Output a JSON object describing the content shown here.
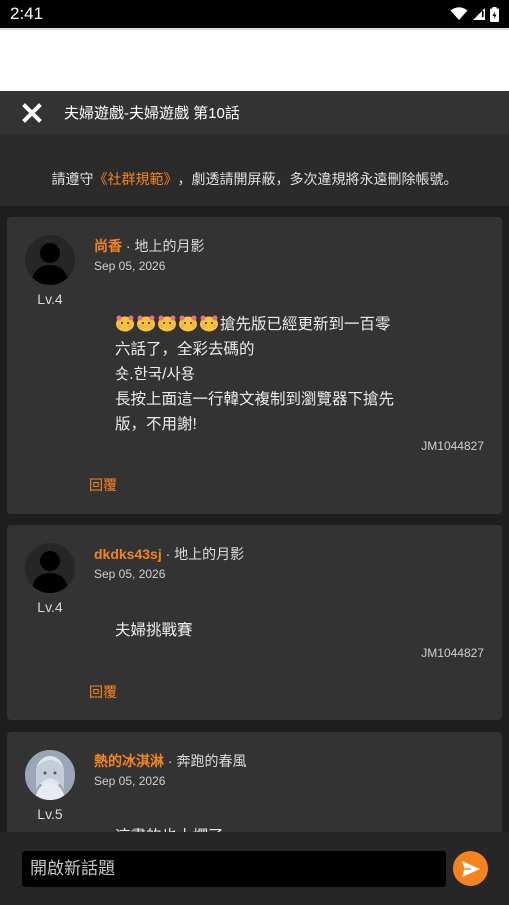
{
  "status_bar": {
    "time": "2:41"
  },
  "top_bar": {
    "title": "夫婦遊戲-夫婦遊戲 第10話"
  },
  "notice": {
    "prefix": "請遵守",
    "rules_link": "《社群規範》",
    "suffix": "，劇透請開屏蔽，多次違規將永遠刪除帳號。"
  },
  "comments": [
    {
      "username": "尚香",
      "subtitle": " · 地上的月影",
      "date": "Sep 05, 2026",
      "level": "Lv.4",
      "emoji_count": 5,
      "lines": [
        "搶先版已經更新到一百零",
        "六話了，全彩去碼的",
        "숏.한국/사용",
        "長按上面這一行韓文複制到瀏覽器下搶先",
        "版，不用謝!"
      ],
      "code": "JM1044827",
      "reply_label": "回覆"
    },
    {
      "username": "dkdks43sj",
      "subtitle": " · 地上的月影",
      "date": "Sep 05, 2026",
      "level": "Lv.4",
      "lines": [
        "夫婦挑戰賽"
      ],
      "code": "JM1044827",
      "reply_label": "回覆"
    },
    {
      "username": "熱的冰淇淋",
      "subtitle": " · 奔跑的春風",
      "date": "Sep 05, 2026",
      "level": "Lv.5",
      "lines": [
        "這畫的也太爛了"
      ]
    }
  ],
  "composer": {
    "placeholder": "開啟新話題"
  },
  "colors": {
    "accent": "#f5841f",
    "card": "#333333",
    "background": "#1e1e1e"
  },
  "icons": {
    "close": "close-icon",
    "send": "send-icon",
    "wifi": "wifi-icon",
    "signal": "signal-icon",
    "battery": "battery-icon"
  }
}
